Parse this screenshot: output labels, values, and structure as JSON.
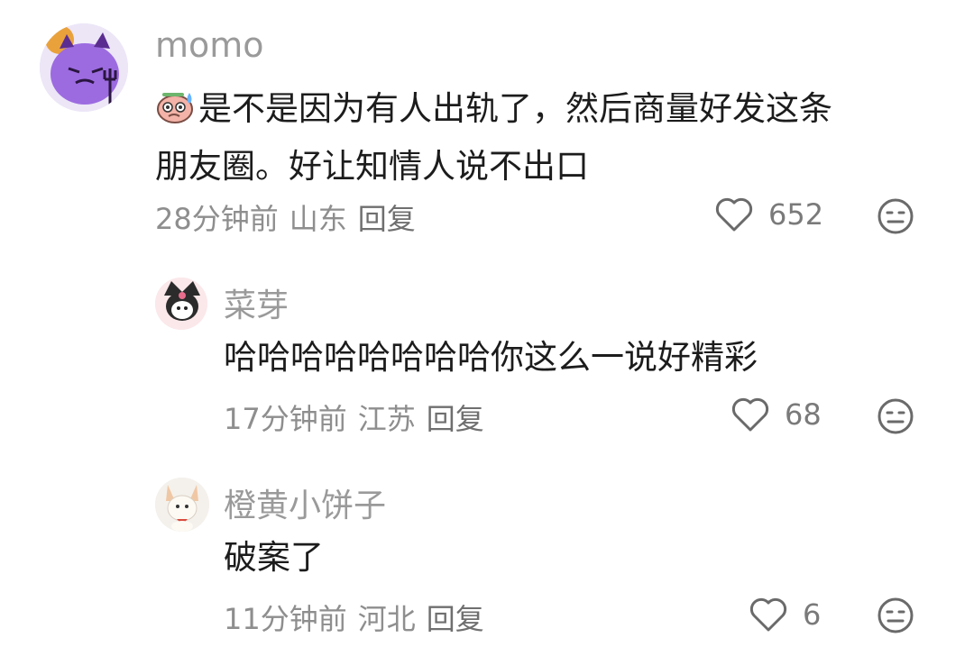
{
  "comments": [
    {
      "username": "momo",
      "content_line1": "是不是因为有人出轨了，然后商量好发这条",
      "content_line2": "朋友圈。好让知情人说不出口",
      "inline_emoji": "sweat-face-emoji",
      "time": "28分钟前",
      "location": "山东",
      "reply_label": "回复",
      "likes": "652",
      "avatar": "purple-devil-avatar"
    },
    {
      "username": "菜芽",
      "content": "哈哈哈哈哈哈哈哈你这么一说好精彩",
      "time": "17分钟前",
      "location": "江苏",
      "reply_label": "回复",
      "likes": "68",
      "avatar": "kuromi-avatar"
    },
    {
      "username": "橙黄小饼子",
      "content": "破案了",
      "time": "11分钟前",
      "location": "河北",
      "reply_label": "回复",
      "likes": "6",
      "avatar": "fox-avatar"
    }
  ],
  "icons": {
    "like": "heart-outline-icon",
    "dislike": "neutral-face-icon"
  },
  "colors": {
    "text": "#1c1c1c",
    "meta": "#8e8e8e",
    "username": "#9a9a9a",
    "icon": "#6a6a6a"
  }
}
